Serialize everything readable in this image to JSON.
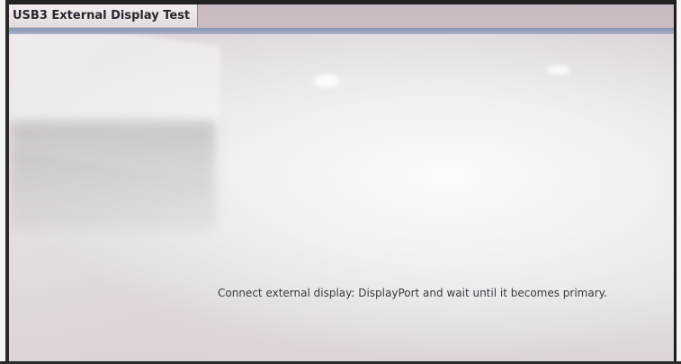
{
  "window": {
    "tabs": [
      {
        "label": "USB3 External Display Test",
        "active": true
      }
    ]
  },
  "main": {
    "instruction": "Connect external display: DisplayPort and wait until it becomes primary."
  },
  "colors": {
    "tab_strip": "#c9b9c2",
    "accent_stripe": "#8794b3",
    "text": "#3e3a40"
  }
}
